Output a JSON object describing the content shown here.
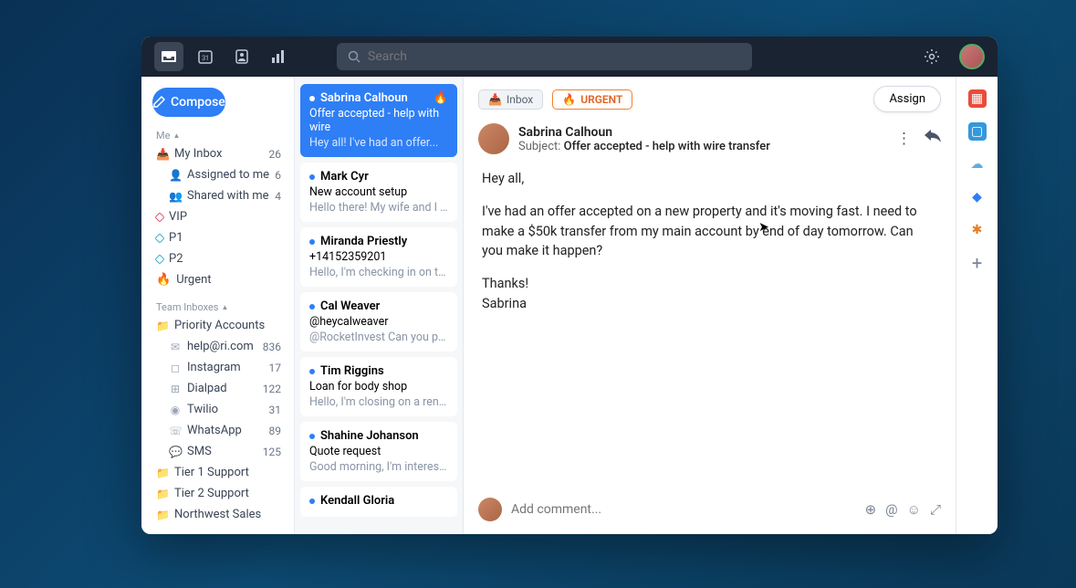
{
  "topbar": {
    "search_placeholder": "Search"
  },
  "sidebar": {
    "compose": "Compose",
    "me_label": "Me",
    "my_inbox": {
      "label": "My Inbox",
      "count": 26
    },
    "assigned": {
      "label": "Assigned to me",
      "count": 6
    },
    "shared": {
      "label": "Shared with me",
      "count": 4
    },
    "tags": [
      {
        "label": "VIP",
        "color": "#e05570"
      },
      {
        "label": "P1",
        "color": "#3aaed0"
      },
      {
        "label": "P2",
        "color": "#3aaed0"
      }
    ],
    "urgent": "Urgent",
    "team_label": "Team Inboxes",
    "priority": "Priority Accounts",
    "channels": [
      {
        "label": "help@ri.com",
        "count": 836
      },
      {
        "label": "Instagram",
        "count": 17
      },
      {
        "label": "Dialpad",
        "count": 122
      },
      {
        "label": "Twilio",
        "count": 31
      },
      {
        "label": "WhatsApp",
        "count": 89
      },
      {
        "label": "SMS",
        "count": 125
      }
    ],
    "tier1": "Tier 1 Support",
    "tier2": "Tier 2 Support",
    "northwest": "Northwest Sales"
  },
  "threads": [
    {
      "from": "Sabrina Calhoun",
      "subject": "Offer accepted - help with wire",
      "preview": "Hey all! I've had an offer...",
      "urgent": true,
      "active": true
    },
    {
      "from": "Mark Cyr",
      "subject": "New account setup",
      "preview": "Hello there! My wife and I are..."
    },
    {
      "from": "Miranda Priestly",
      "subject": "+14152359201",
      "preview": "Hello, I'm checking in on the"
    },
    {
      "from": "Cal Weaver",
      "subject": "@heycalweaver",
      "preview": "@RocketInvest Can you please"
    },
    {
      "from": "Tim Riggins",
      "subject": "Loan for body shop",
      "preview": "Hello, I'm closing on a rental..."
    },
    {
      "from": "Shahine Johanson",
      "subject": "Quote request",
      "preview": "Good morning, I'm interested"
    },
    {
      "from": "Kendall Gloria",
      "subject": "",
      "preview": ""
    }
  ],
  "mail": {
    "inbox_pill": "Inbox",
    "urgent_pill": "URGENT",
    "assign": "Assign",
    "sender": "Sabrina Calhoun",
    "subject_prefix": "Subject:",
    "subject": "Offer accepted - help with wire transfer",
    "body_greeting": "Hey all,",
    "body_main": "I've had an offer accepted on a new property and it's moving fast. I need to make a $50k transfer from my main account by end of day tomorrow. Can you make it happen?",
    "body_signoff1": "Thanks!",
    "body_signoff2": "Sabrina",
    "comment_placeholder": "Add comment..."
  }
}
